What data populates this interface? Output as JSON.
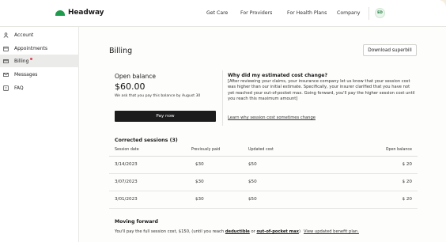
{
  "header": {
    "brand": "Headway",
    "nav": [
      "Get Care",
      "For Providers",
      "For Health Plans",
      "Company"
    ],
    "avatar_initials": "ED",
    "brand_color": "#1f9b4e"
  },
  "sidebar": {
    "items": [
      {
        "label": "Account",
        "icon": "person-icon"
      },
      {
        "label": "Appointments",
        "icon": "calendar-icon"
      },
      {
        "label": "Billing",
        "icon": "card-icon",
        "active": true,
        "notification": true
      },
      {
        "label": "Messages",
        "icon": "mail-icon"
      },
      {
        "label": "FAQ",
        "icon": "question-icon"
      }
    ]
  },
  "main": {
    "title": "Billing",
    "download_label": "Download superbill",
    "open_balance": {
      "label": "Open balance",
      "amount": "$60.00",
      "note": "We ask that you pay this balance by August 30",
      "pay_label": "Pay now"
    },
    "why": {
      "title": "Why did my estimated cost change?",
      "body": "[After reviewing your claims, your insurance company let us know that your session cost was higher than our initial estimate. Specifically, your insurer clarified that you have not yet reached your out-of-pocket max. Going forward, you'll pay the higher session cost until you reach this maximum amount]",
      "link": "Learn why session cost sometimes change"
    },
    "corrected": {
      "title": "Corrected sessions (3)",
      "columns": [
        "Session date",
        "Previously paid",
        "Updated cost",
        "Open balance"
      ],
      "rows": [
        [
          "3/14/2023",
          "$30",
          "$50",
          "$ 20"
        ],
        [
          "3/07/2023",
          "$30",
          "$50",
          "$ 20"
        ],
        [
          "3/01/2023",
          "$30",
          "$50",
          "$ 20"
        ]
      ]
    },
    "moving_forward": {
      "title": "Moving forward",
      "text_before": "You'll pay the full session cost, $150, (until you reach ",
      "deductible": "deductible",
      "or": " or ",
      "oop": "out-of-pocket max",
      "text_after": ")",
      "link": "View updated benefit plan."
    }
  }
}
